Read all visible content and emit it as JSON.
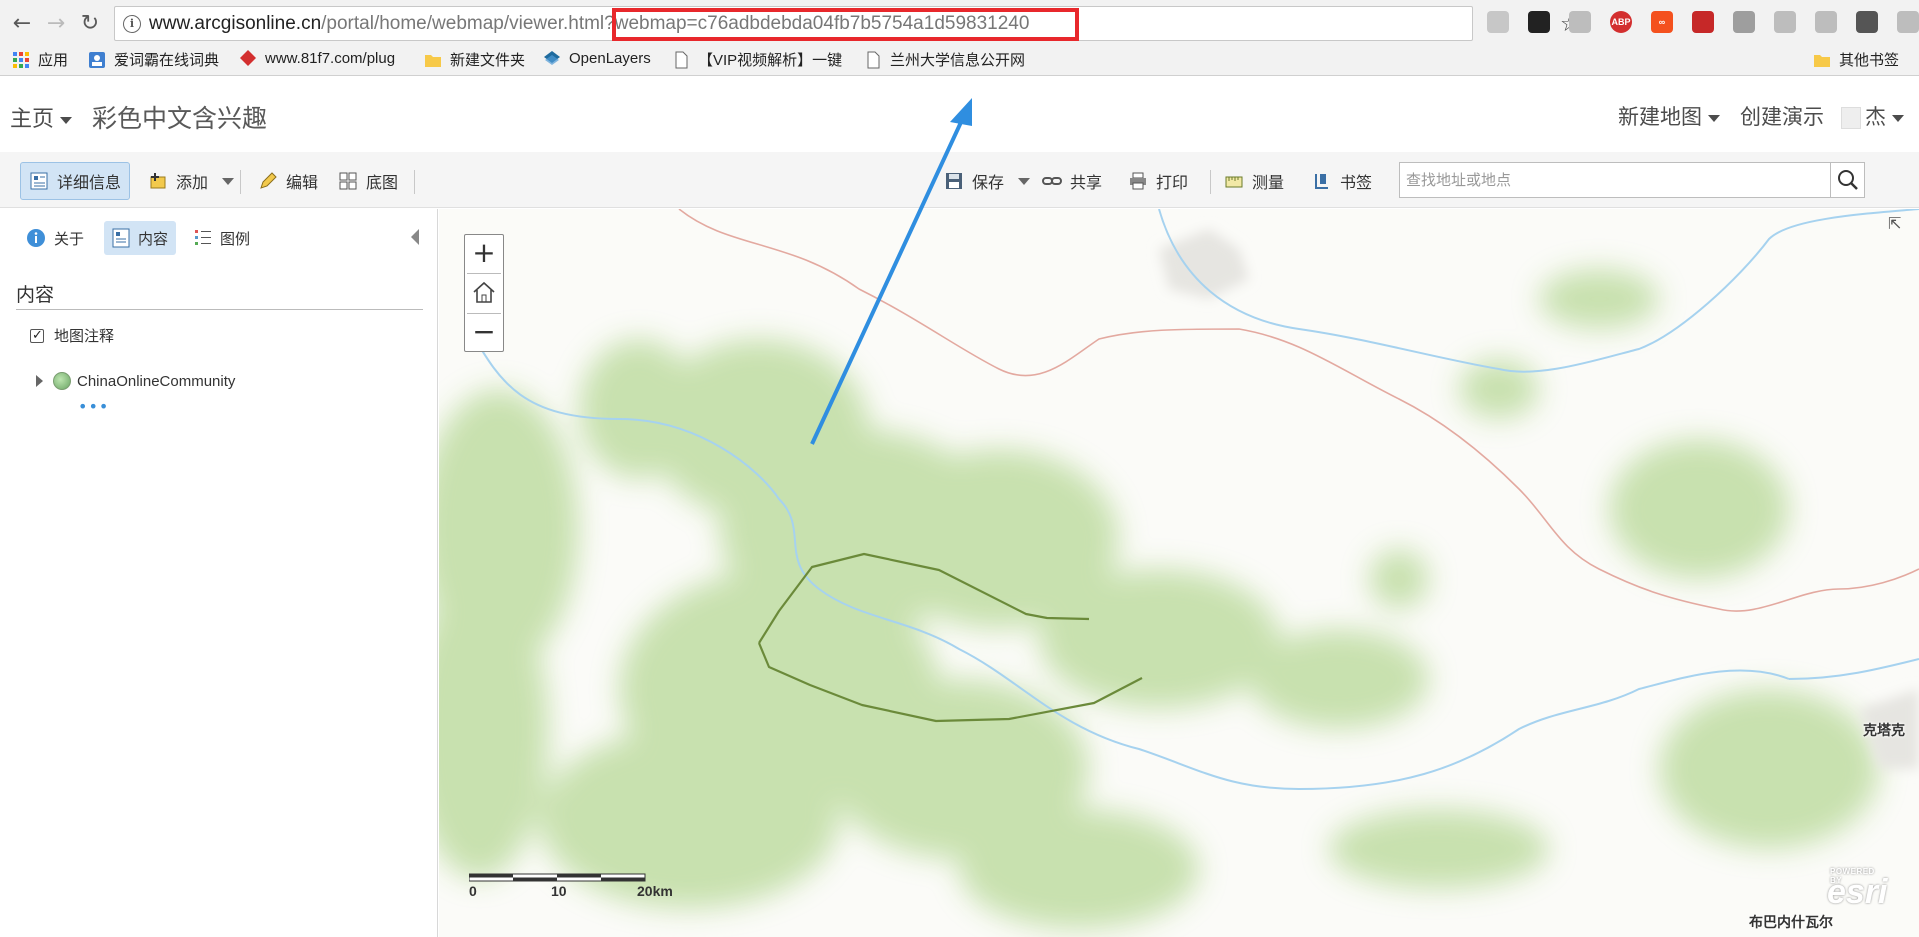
{
  "browser": {
    "url_host": "www.arcgisonline.cn",
    "url_path": "/portal/home/webmap/viewer.html",
    "url_query": "?webmap=c76adbdebda04fb7b5754a1d59831240",
    "highlight_color": "#e8282c",
    "bookmarks": [
      {
        "label": "应用",
        "icon": "apps-grid-icon"
      },
      {
        "label": "爱词霸在线词典",
        "icon": "iciba-icon"
      },
      {
        "label": "www.81f7.com/plug",
        "icon": "red-diamond-icon"
      },
      {
        "label": "新建文件夹",
        "icon": "folder-icon"
      },
      {
        "label": "OpenLayers",
        "icon": "openlayers-icon"
      },
      {
        "label": "【VIP视频解析】一键",
        "icon": "page-icon"
      },
      {
        "label": "兰州大学信息公开网",
        "icon": "page-icon"
      }
    ],
    "other_bookmarks": "其他书签",
    "extensions": [
      {
        "text": "",
        "color": "#c7c7c7",
        "icon": "search-ext-icon"
      },
      {
        "text": "",
        "color": "#222222",
        "icon": "x-ext-icon"
      },
      {
        "text": "",
        "color": "#bdbdbd",
        "icon": "page-ext-icon"
      },
      {
        "text": "ABP",
        "color": "#d32f2f",
        "icon": "adblock-plus-icon"
      },
      {
        "text": "∞",
        "color": "#f4511e",
        "icon": "infinity-ext-icon"
      },
      {
        "text": "",
        "color": "#c62828",
        "icon": "tool-ext-icon"
      },
      {
        "text": "",
        "color": "#9e9e9e",
        "icon": "v-ext-icon"
      },
      {
        "text": "",
        "color": "#bdbdbd",
        "icon": "esri-ext-icon"
      },
      {
        "text": "",
        "color": "#bdbdbd",
        "icon": "esri-ext-icon-2"
      },
      {
        "text": "",
        "color": "#555555",
        "icon": "robot-ext-icon"
      },
      {
        "text": "",
        "color": "#bdbdbd",
        "icon": "grid-ext-icon"
      },
      {
        "text": "",
        "color": "#d32f2f",
        "icon": "upload-ext-icon"
      }
    ]
  },
  "header": {
    "home": "主页",
    "map_title": "彩色中文含兴趣",
    "new_map": "新建地图",
    "create_presentation": "创建演示",
    "user": "杰"
  },
  "toolbar": {
    "details": "详细信息",
    "add": "添加",
    "edit": "编辑",
    "basemap": "底图",
    "save": "保存",
    "share": "共享",
    "print": "打印",
    "measure": "测量",
    "bookmarks": "书签",
    "search_placeholder": "查找地址或地点"
  },
  "panel": {
    "tabs": {
      "about": "关于",
      "content": "内容",
      "legend": "图例"
    },
    "content_title": "内容",
    "layers": [
      {
        "label": "地图注释",
        "checked": true
      },
      {
        "label": "ChinaOnlineCommunity",
        "checked": false
      }
    ],
    "more": "•••"
  },
  "map": {
    "zoom_in": "+",
    "zoom_out": "−",
    "scale_labels": [
      "0",
      "10",
      "20km"
    ],
    "place_labels": [
      "克塔克",
      "布巴内什瓦尔"
    ],
    "esri_powered": "POWERED BY",
    "esri_logo": "esri",
    "colors": {
      "sketch_line": "#6b8a3a",
      "river": "#a6d2ef",
      "border": "#e3a9a0",
      "vegetation": "#c6e0ac"
    }
  }
}
